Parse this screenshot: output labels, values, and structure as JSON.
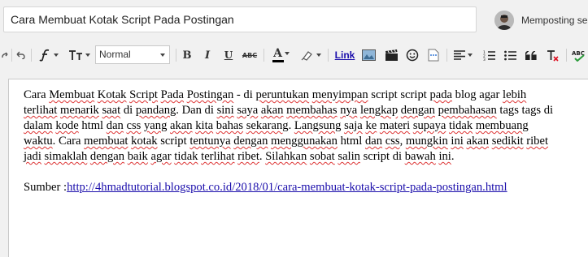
{
  "header": {
    "title_value": "Cara Membuat Kotak Script Pada Postingan",
    "post_as_label": "Memposting sebagai"
  },
  "toolbar": {
    "font_select_value": "Normal",
    "bold_label": "B",
    "italic_label": "I",
    "underline_label": "U",
    "strike_label": "ABC",
    "text_color_label": "A",
    "link_label": "Link",
    "text_color": "#000000"
  },
  "body": {
    "paragraph_parts": [
      {
        "t": "Cara ",
        "sp": false
      },
      {
        "t": "Membuat",
        "sp": true
      },
      {
        "t": " ",
        "sp": false
      },
      {
        "t": "Kotak",
        "sp": true
      },
      {
        "t": " ",
        "sp": false
      },
      {
        "t": "Script",
        "sp": true
      },
      {
        "t": " ",
        "sp": false
      },
      {
        "t": "Pada",
        "sp": true
      },
      {
        "t": " ",
        "sp": false
      },
      {
        "t": "Postingan",
        "sp": true
      },
      {
        "t": " - di ",
        "sp": false
      },
      {
        "t": "peruntukan",
        "sp": true
      },
      {
        "t": " ",
        "sp": false
      },
      {
        "t": "menyimpan",
        "sp": true
      },
      {
        "t": " script script ",
        "sp": false
      },
      {
        "t": "pada",
        "sp": true
      },
      {
        "t": " blog agar ",
        "sp": false
      },
      {
        "t": "lebih",
        "sp": true
      },
      {
        "t": " ",
        "sp": false
      },
      {
        "t": "terlihat",
        "sp": true
      },
      {
        "t": " ",
        "sp": false
      },
      {
        "t": "menarik",
        "sp": true
      },
      {
        "t": " ",
        "sp": false
      },
      {
        "t": "saat",
        "sp": true
      },
      {
        "t": " di ",
        "sp": false
      },
      {
        "t": "pandang",
        "sp": true
      },
      {
        "t": ". Dan di ",
        "sp": false
      },
      {
        "t": "sini",
        "sp": true
      },
      {
        "t": " ",
        "sp": false
      },
      {
        "t": "saya",
        "sp": true
      },
      {
        "t": " ",
        "sp": false
      },
      {
        "t": "akan",
        "sp": true
      },
      {
        "t": " ",
        "sp": false
      },
      {
        "t": "membahas",
        "sp": true
      },
      {
        "t": " ",
        "sp": false
      },
      {
        "t": "nya",
        "sp": true
      },
      {
        "t": " ",
        "sp": false
      },
      {
        "t": "lengkap",
        "sp": true
      },
      {
        "t": " ",
        "sp": false
      },
      {
        "t": "dengan",
        "sp": true
      },
      {
        "t": " ",
        "sp": false
      },
      {
        "t": "pembahasan",
        "sp": true
      },
      {
        "t": " tags tags di ",
        "sp": false
      },
      {
        "t": "dalam",
        "sp": true
      },
      {
        "t": " ",
        "sp": false
      },
      {
        "t": "kode",
        "sp": true
      },
      {
        "t": " html ",
        "sp": false
      },
      {
        "t": "dan",
        "sp": true
      },
      {
        "t": " ",
        "sp": false
      },
      {
        "t": "css",
        "sp": true
      },
      {
        "t": " ",
        "sp": false
      },
      {
        "t": "yang",
        "sp": true
      },
      {
        "t": " ",
        "sp": false
      },
      {
        "t": "akan",
        "sp": true
      },
      {
        "t": " ",
        "sp": false
      },
      {
        "t": "kita",
        "sp": true
      },
      {
        "t": " ",
        "sp": false
      },
      {
        "t": "bahas",
        "sp": true
      },
      {
        "t": " ",
        "sp": false
      },
      {
        "t": "sekarang",
        "sp": true
      },
      {
        "t": ". ",
        "sp": false
      },
      {
        "t": "Langsung",
        "sp": true
      },
      {
        "t": " ",
        "sp": false
      },
      {
        "t": "saja",
        "sp": true
      },
      {
        "t": " ",
        "sp": false
      },
      {
        "t": "ke",
        "sp": true
      },
      {
        "t": " ",
        "sp": false
      },
      {
        "t": "materi",
        "sp": true
      },
      {
        "t": " ",
        "sp": false
      },
      {
        "t": "supaya",
        "sp": true
      },
      {
        "t": " ",
        "sp": false
      },
      {
        "t": "tidak",
        "sp": true
      },
      {
        "t": " ",
        "sp": false
      },
      {
        "t": "membuang",
        "sp": true
      },
      {
        "t": " ",
        "sp": false
      },
      {
        "t": "waktu",
        "sp": true
      },
      {
        "t": ". Cara ",
        "sp": false
      },
      {
        "t": "membuat",
        "sp": true
      },
      {
        "t": " ",
        "sp": false
      },
      {
        "t": "kotak",
        "sp": true
      },
      {
        "t": " script ",
        "sp": false
      },
      {
        "t": "tentunya",
        "sp": true
      },
      {
        "t": " ",
        "sp": false
      },
      {
        "t": "dengan",
        "sp": true
      },
      {
        "t": " ",
        "sp": false
      },
      {
        "t": "menggunakan",
        "sp": true
      },
      {
        "t": " html ",
        "sp": false
      },
      {
        "t": "dan",
        "sp": true
      },
      {
        "t": " ",
        "sp": false
      },
      {
        "t": "css",
        "sp": true
      },
      {
        "t": ", ",
        "sp": false
      },
      {
        "t": "mungkin",
        "sp": true
      },
      {
        "t": " ",
        "sp": false
      },
      {
        "t": "ini",
        "sp": true
      },
      {
        "t": " ",
        "sp": false
      },
      {
        "t": "akan",
        "sp": true
      },
      {
        "t": " ",
        "sp": false
      },
      {
        "t": "sedikit",
        "sp": true
      },
      {
        "t": " ",
        "sp": false
      },
      {
        "t": "ribet",
        "sp": true
      },
      {
        "t": " ",
        "sp": false
      },
      {
        "t": "jadi",
        "sp": true
      },
      {
        "t": " ",
        "sp": false
      },
      {
        "t": "simaklah",
        "sp": true
      },
      {
        "t": " ",
        "sp": false
      },
      {
        "t": "dengan",
        "sp": true
      },
      {
        "t": " ",
        "sp": false
      },
      {
        "t": "baik",
        "sp": true
      },
      {
        "t": " ",
        "sp": false
      },
      {
        "t": "agar",
        "sp": true
      },
      {
        "t": " ",
        "sp": false
      },
      {
        "t": "tidak",
        "sp": true
      },
      {
        "t": " ",
        "sp": false
      },
      {
        "t": "terlihat",
        "sp": true
      },
      {
        "t": " ",
        "sp": false
      },
      {
        "t": "ribet",
        "sp": true
      },
      {
        "t": ". ",
        "sp": false
      },
      {
        "t": "Silahkan",
        "sp": true
      },
      {
        "t": " ",
        "sp": false
      },
      {
        "t": "sobat",
        "sp": true
      },
      {
        "t": " ",
        "sp": false
      },
      {
        "t": "salin",
        "sp": true
      },
      {
        "t": " script di ",
        "sp": false
      },
      {
        "t": "bawah",
        "sp": true
      },
      {
        "t": " ",
        "sp": false
      },
      {
        "t": "ini",
        "sp": true
      },
      {
        "t": ".",
        "sp": false
      }
    ],
    "source_label": "Sumber :",
    "source_url": "http://4hmadtutorial.blogspot.co.id/2018/01/cara-membuat-kotak-script-pada-postingan.html"
  }
}
